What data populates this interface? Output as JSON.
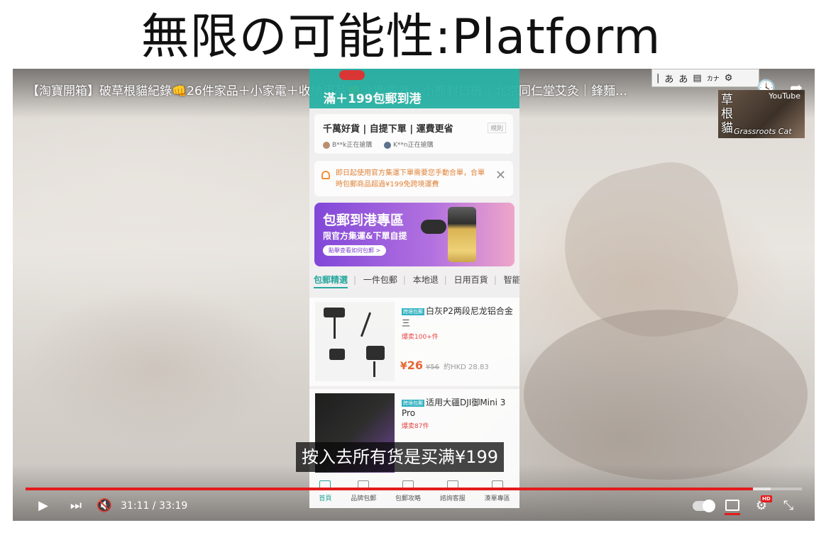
{
  "slide": {
    "title": "無限の可能性:Platform"
  },
  "video": {
    "title": "【淘寶開箱】破草根貓紀錄👊26件家品＋小家電＋收納用品👊北鼎電器｜小熊封口機｜北京同仁堂艾灸｜鋒麵…",
    "subtitle": "按入去所有货是买满¥199",
    "current_time": "31:11",
    "duration": "33:19",
    "time_display": "31:11 / 33:19",
    "progress": 0.937,
    "buffered": 0.96,
    "hd_badge": "HD",
    "muted": true
  },
  "top_controls": {
    "watch_later_icon": "clock-icon",
    "share_icon": "share-icon",
    "info_icon": "info-icon"
  },
  "ime_toolbar": {
    "items": [
      "あ",
      "あ",
      "カナ",
      "⚙"
    ]
  },
  "channel_logo": {
    "kanji": "草根貓",
    "brand": "Grassroots Cat",
    "yt": "YouTube"
  },
  "phone": {
    "header_text": "滿＋199包郵到港",
    "card1": {
      "title": "千萬好貨 | 自提下單 | 運費更省",
      "rule": "規則",
      "buyer1": "B**k正在搶購",
      "buyer2": "K**n正在搶購"
    },
    "notice": {
      "text": "即日起使用官方集運下單需要您手動合單，合單時包郵商品超過¥199免跨境運費",
      "close": "✕"
    },
    "banner": {
      "title": "包郵到港專區",
      "sub": "限官方集運&下單自提",
      "link": "點擊查看如何包郵 >"
    },
    "tabs": [
      "包郵精選",
      "一件包郵",
      "本地退",
      "日用百貨",
      "智能"
    ],
    "products": [
      {
        "tag": "跨境包郵",
        "name": "白灰P2两段尼龙铝合金三",
        "hot": "爆卖100+件",
        "currency": "¥",
        "price": "26",
        "orig": "¥56",
        "hkd": "約HKD 28.83"
      },
      {
        "tag": "跨境包郵",
        "name": "适用大疆DJI御Mini 3 Pro",
        "hot": "爆卖87件"
      }
    ],
    "bottom_nav": [
      "首頁",
      "品牌包郵",
      "包郵攻略",
      "諮詢客服",
      "湊單專區"
    ]
  }
}
